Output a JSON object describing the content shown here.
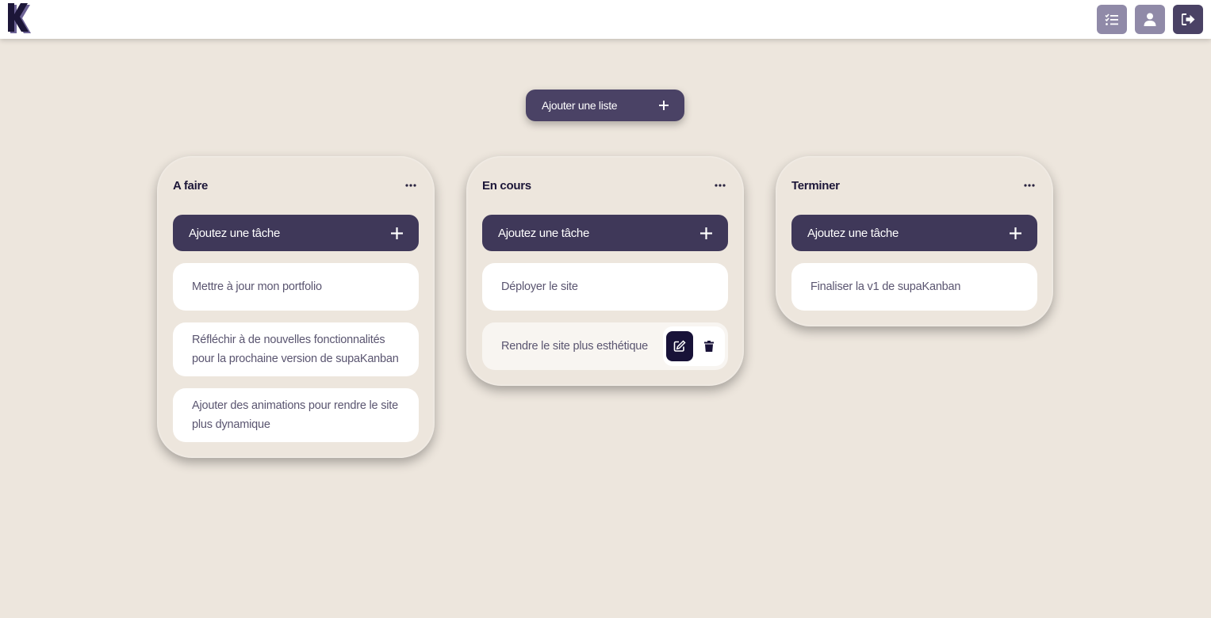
{
  "header": {
    "logo_letter": "K",
    "actions": [
      {
        "name": "tasks-button",
        "icon": "checklist-icon"
      },
      {
        "name": "profile-button",
        "icon": "user-icon"
      },
      {
        "name": "logout-button",
        "icon": "logout-icon"
      }
    ]
  },
  "board": {
    "add_list_label": "Ajouter une liste",
    "lists": [
      {
        "title": "A faire",
        "add_task_label": "Ajoutez une tâche",
        "cards": [
          "Mettre à jour mon portfolio",
          "Réfléchir à de nouvelles fonctionnalités pour la prochaine version de supaKanban",
          "Ajouter des animations pour rendre le site plus dynamique"
        ]
      },
      {
        "title": "En cours",
        "add_task_label": "Ajoutez une tâche",
        "cards": [
          "Déployer le site",
          "Rendre le site plus esthétique"
        ]
      },
      {
        "title": "Terminer",
        "add_task_label": "Ajoutez une tâche",
        "cards": [
          "Finaliser la v1 de supaKanban"
        ]
      }
    ]
  },
  "colors": {
    "background": "#ede6dd",
    "primary": "#3f3859",
    "accent_dark": "#181238",
    "card": "#ffffff"
  }
}
